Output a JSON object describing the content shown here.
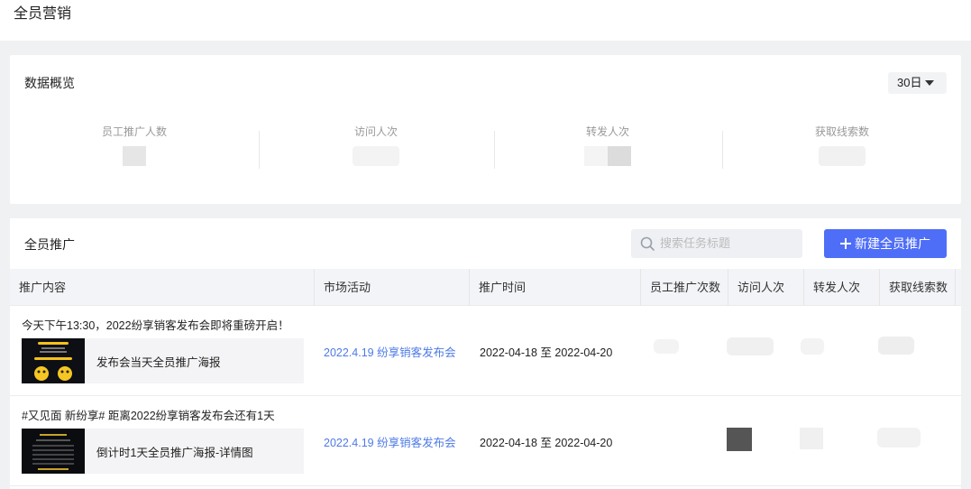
{
  "header": {
    "title": "全员营销"
  },
  "overview": {
    "title": "数据概览",
    "range": "30日",
    "stats": [
      {
        "label": "员工推广人数"
      },
      {
        "label": "访问人次"
      },
      {
        "label": "转发人次"
      },
      {
        "label": "获取线索数"
      }
    ]
  },
  "promotion": {
    "title": "全员推广",
    "search_placeholder": "搜索任务标题",
    "new_button": "新建全员推广",
    "columns": [
      "推广内容",
      "市场活动",
      "推广时间",
      "员工推广次数",
      "访问人次",
      "转发人次",
      "获取线索数"
    ],
    "rows": [
      {
        "headline": "今天下午13:30，2022纷享销客发布会即将重磅开启！",
        "poster": "发布会当天全员推广海报",
        "activity": "2022.4.19 纷享销客发布会",
        "time": "2022-04-18 至 2022-04-20"
      },
      {
        "headline": "#又见面 新纷享# 距离2022纷享销客发布会还有1天",
        "poster": "倒计时1天全员推广海报-详情图",
        "activity": "2022.4.19 纷享销客发布会",
        "time": "2022-04-18 至 2022-04-20"
      }
    ]
  },
  "colors": {
    "primary": "#4f6ef7",
    "link": "#4e7ae6"
  }
}
